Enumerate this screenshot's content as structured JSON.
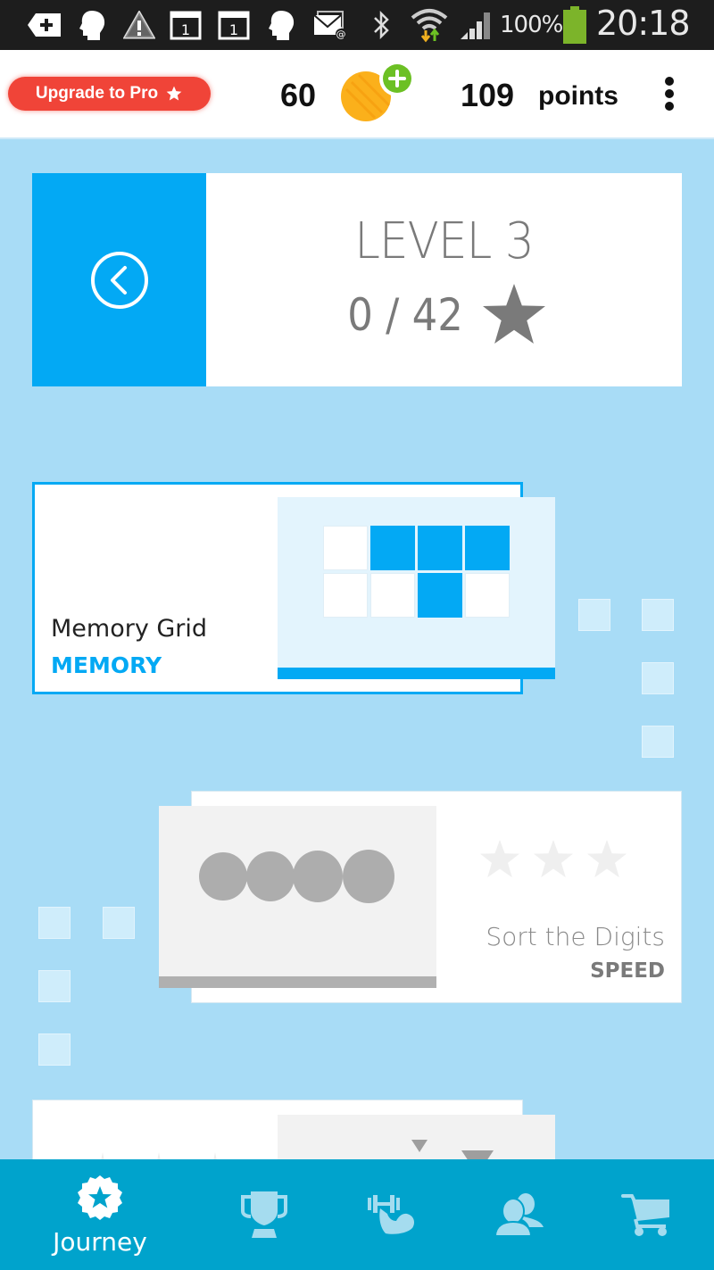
{
  "status_bar": {
    "battery_percent": "100%",
    "time": "20:18",
    "icons": [
      "add-notification-icon",
      "head-icon",
      "warning-icon",
      "calendar-icon",
      "calendar-icon",
      "head-icon",
      "email-icon",
      "bluetooth-icon",
      "wifi-icon",
      "signal-icon",
      "battery-icon"
    ],
    "calendar_day": "1"
  },
  "header": {
    "upgrade_label": "Upgrade to Pro",
    "coins": "60",
    "points_value": "109",
    "points_label": "points"
  },
  "level": {
    "title": "LEVEL 3",
    "stars_progress": "0 / 42"
  },
  "games": [
    {
      "name": "Memory Grid",
      "category": "MEMORY",
      "category_color": "#03a9f4",
      "grid": [
        [
          0,
          1,
          1,
          1
        ],
        [
          0,
          0,
          1,
          0
        ]
      ]
    },
    {
      "name": "Sort the Digits",
      "category": "SPEED",
      "category_color": "#7a7a7a",
      "stars_earned": 0,
      "stars_total": 3
    },
    {
      "name": "",
      "category": ""
    }
  ],
  "bottom_nav": {
    "items": [
      {
        "label": "Journey",
        "icon": "badge-star-icon",
        "active": true
      },
      {
        "label": "",
        "icon": "trophy-icon",
        "active": false
      },
      {
        "label": "",
        "icon": "dumbbell-arm-icon",
        "active": false
      },
      {
        "label": "",
        "icon": "friends-icon",
        "active": false
      },
      {
        "label": "",
        "icon": "cart-icon",
        "active": false
      }
    ]
  },
  "colors": {
    "accent": "#03a9f4",
    "background": "#a8dcf6",
    "nav": "#00a3cc",
    "upgrade": "#f04438",
    "coin": "#fbb01b",
    "coin_plus": "#6cc024",
    "battery": "#7cb42a"
  }
}
